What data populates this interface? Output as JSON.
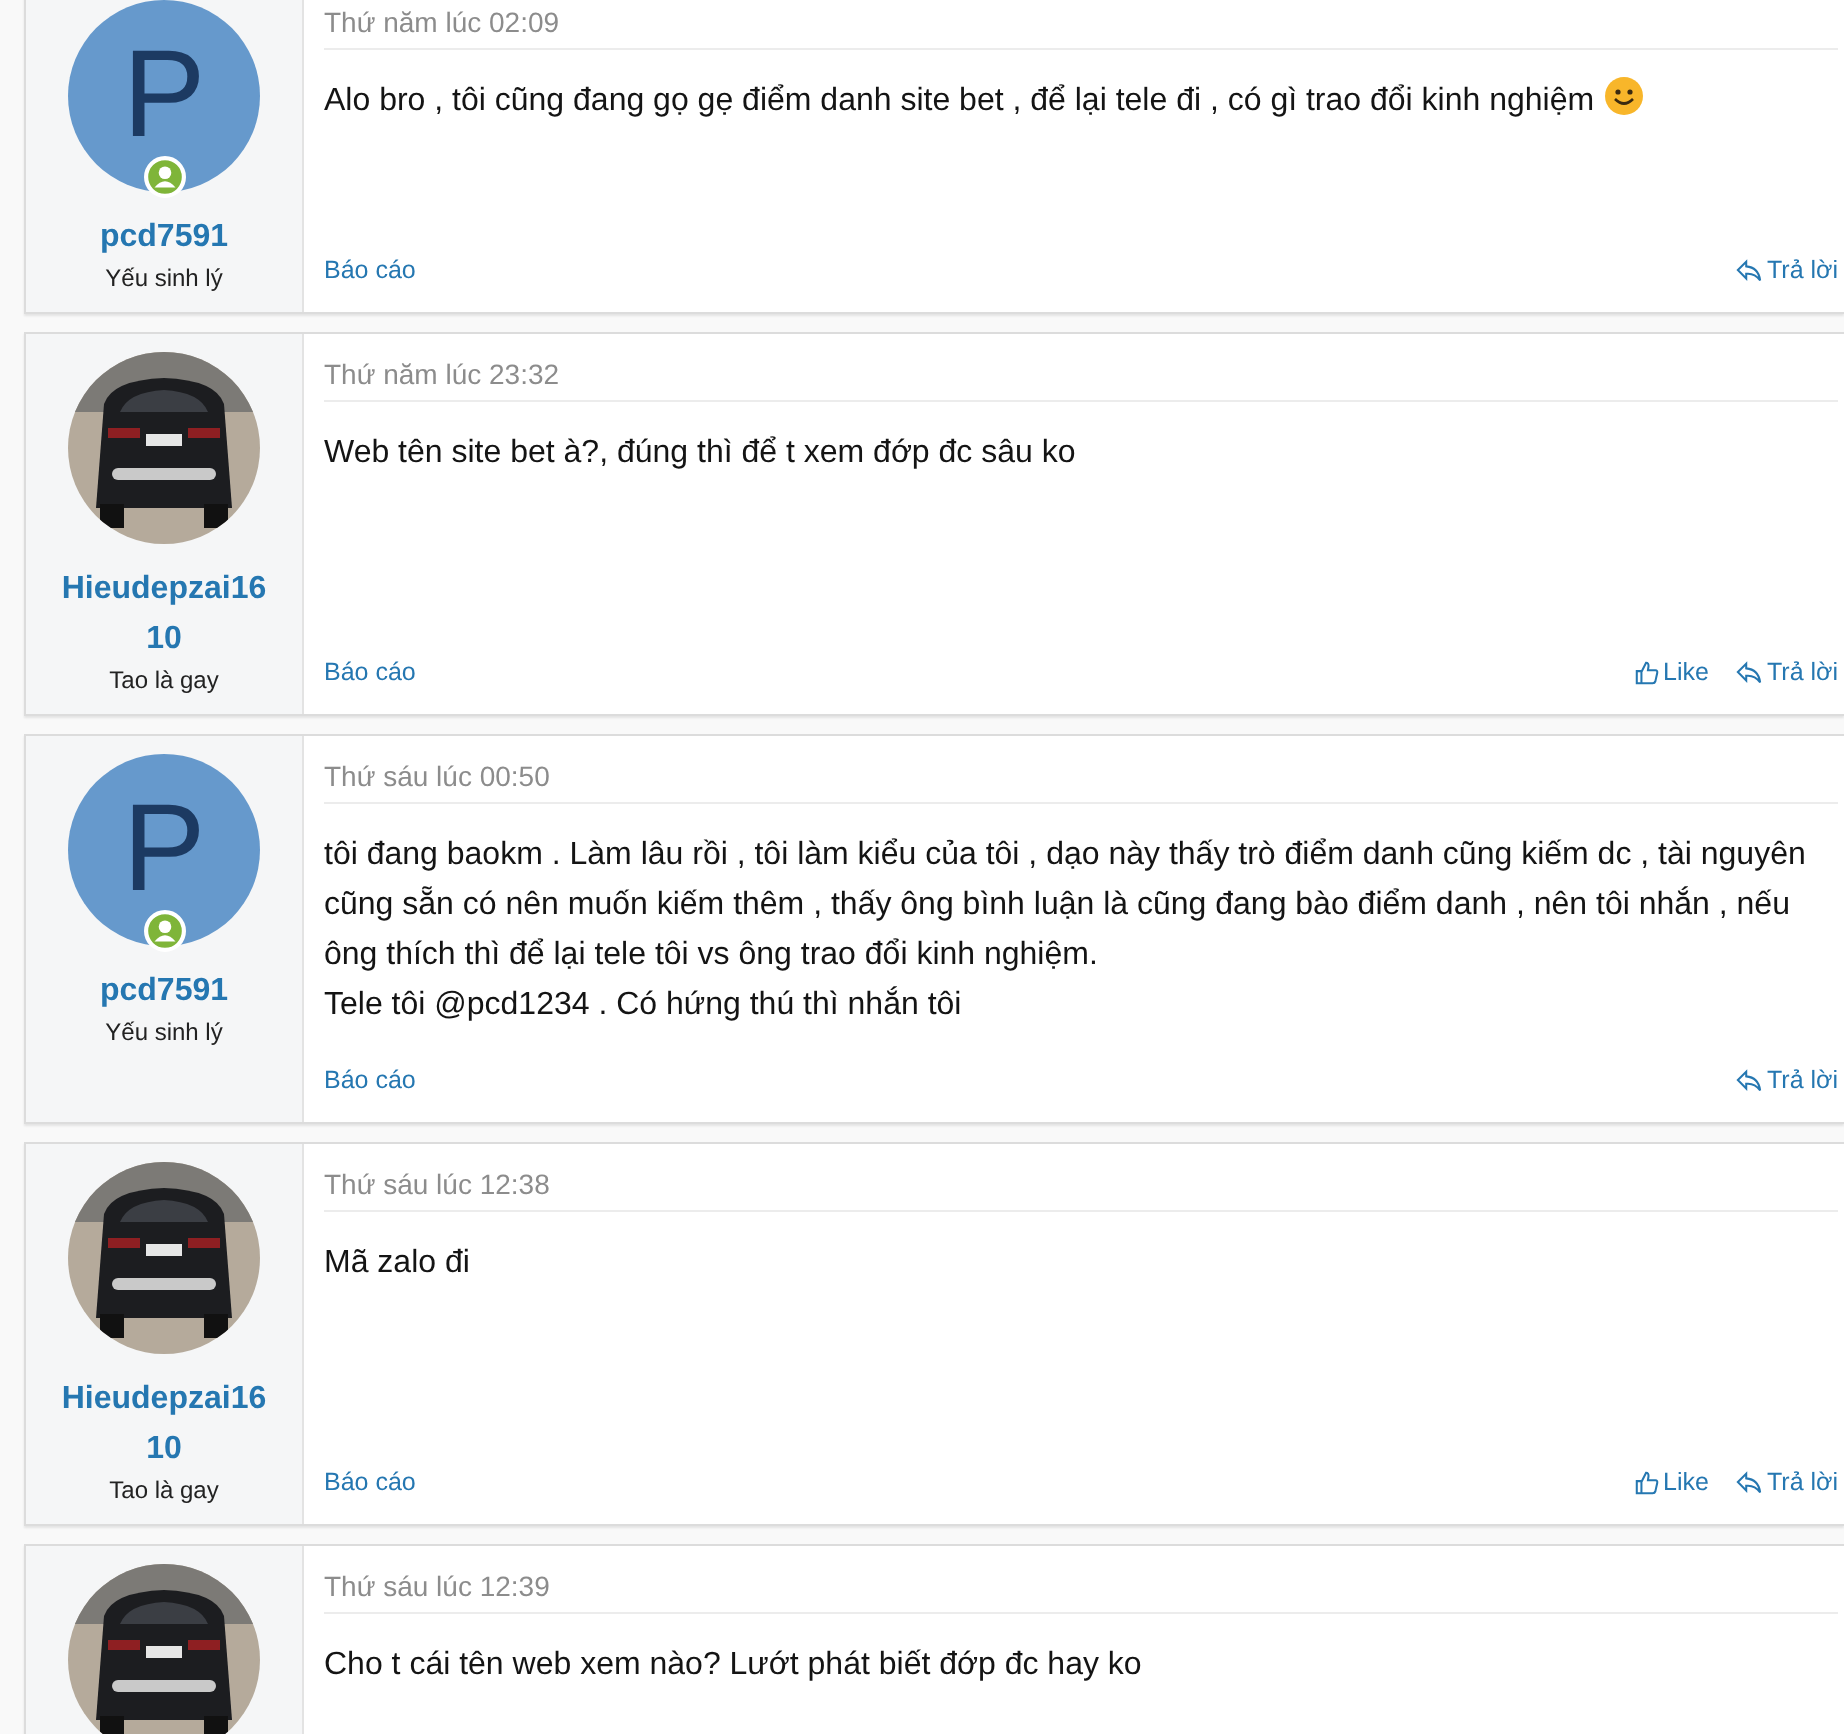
{
  "posts": [
    {
      "user": {
        "name": "pcd7591",
        "title": "Yếu sinh lý",
        "avatar": {
          "kind": "letter",
          "letter": "P",
          "online": true
        }
      },
      "date": "Thứ năm lúc 02:09",
      "paragraphs": [
        "Alo bro , tôi cũng đang gọ gẹ điểm danh site bet , để lại tele đi , có gì trao đổi kinh nghiệm"
      ],
      "emoji": true,
      "report": "Báo cáo",
      "actions": [
        {
          "kind": "reply",
          "label": "Trả lời"
        }
      ]
    },
    {
      "user": {
        "name": "Hieudepzai1610",
        "title": "Tao là gay",
        "avatar": {
          "kind": "picture",
          "online": false
        }
      },
      "date": "Thứ năm lúc 23:32",
      "paragraphs": [
        "Web tên site bet à?, đúng thì để t xem đớp đc sâu ko"
      ],
      "emoji": false,
      "report": "Báo cáo",
      "actions": [
        {
          "kind": "like",
          "label": "Like"
        },
        {
          "kind": "reply",
          "label": "Trả lời"
        }
      ]
    },
    {
      "user": {
        "name": "pcd7591",
        "title": "Yếu sinh lý",
        "avatar": {
          "kind": "letter",
          "letter": "P",
          "online": true
        }
      },
      "date": "Thứ sáu lúc 00:50",
      "paragraphs": [
        "tôi đang baokm . Làm lâu rồi , tôi làm kiểu của tôi , dạo này thấy trò điểm danh cũng kiếm dc , tài nguyên cũng sẵn có nên muốn kiếm thêm , thấy ông bình luận là cũng đang bào điểm danh , nên tôi nhắn , nếu ông thích thì để lại tele tôi vs ông trao đổi kinh nghiệm.",
        "Tele tôi @pcd1234 . Có hứng thú thì nhắn tôi"
      ],
      "emoji": false,
      "report": "Báo cáo",
      "actions": [
        {
          "kind": "reply",
          "label": "Trả lời"
        }
      ]
    },
    {
      "user": {
        "name": "Hieudepzai1610",
        "title": "Tao là gay",
        "avatar": {
          "kind": "picture",
          "online": false
        }
      },
      "date": "Thứ sáu lúc 12:38",
      "paragraphs": [
        "Mã zalo đi"
      ],
      "emoji": false,
      "report": "Báo cáo",
      "actions": [
        {
          "kind": "like",
          "label": "Like"
        },
        {
          "kind": "reply",
          "label": "Trả lời"
        }
      ]
    },
    {
      "user": {
        "avatar": {
          "kind": "picture",
          "online": false
        }
      },
      "date": "Thứ sáu lúc 12:39",
      "paragraphs": [
        "Cho t cái tên web xem nào? Lướt phát biết đớp đc hay ko"
      ],
      "emoji": false
    }
  ]
}
